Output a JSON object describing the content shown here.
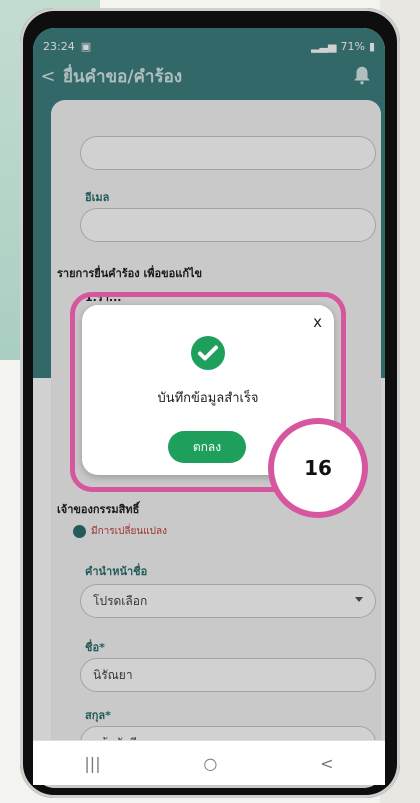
{
  "status_bar": {
    "time": "23:24",
    "battery": "71%"
  },
  "header": {
    "back_symbol": "<",
    "title": "ยื่นคำขอ/คำร้อง",
    "icon": "bell-icon"
  },
  "form": {
    "email_label": "อีเมล",
    "request_section": "รายการยื่นคำร้อง เพื่อขอแก้ไข",
    "item_label": "1.รา...",
    "owner_section": "เจ้าของกรรมสิทธิ์",
    "change_note": "มีการเปลี่ยนแปลง",
    "prefix_label": "คำนำหน้าชื่อ",
    "prefix_placeholder": "โปรดเลือก",
    "first_name_label": "ชื่อ*",
    "first_name_value": "นิรัณยา",
    "last_name_label": "สกุล*",
    "last_name_value": "แก้วบัวดี"
  },
  "dialog": {
    "close_symbol": "x",
    "message": "บันทึกข้อมูลสำเร็จ",
    "ok_label": "ตกลง",
    "icon": "check-circle-icon"
  },
  "annotation": {
    "step_number": "16",
    "accent_color": "#d6569f"
  },
  "navbar": {
    "recent": "|||",
    "home": "○",
    "back": "<"
  },
  "colors": {
    "header_teal": "#3f7f7f",
    "button_green": "#1e9f5b"
  }
}
